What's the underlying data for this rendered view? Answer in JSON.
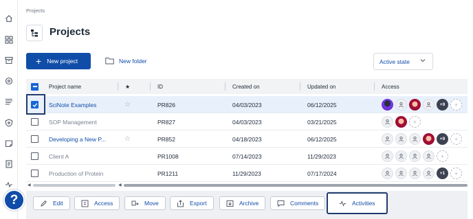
{
  "breadcrumb": "Projects",
  "page_title": "Projects",
  "toolbar": {
    "new_project_label": "New project",
    "new_folder_label": "New folder",
    "state_filter_value": "Active state"
  },
  "table": {
    "columns": [
      "Project name",
      "★",
      "ID",
      "Created on",
      "Updated on",
      "Access"
    ],
    "rows": [
      {
        "name": "SciNote Examples",
        "starred": false,
        "id": "PR826",
        "created": "04/03/2023",
        "updated": "06/12/2025",
        "selected": true,
        "muted": false,
        "extra_count": "+9"
      },
      {
        "name": "SOP Management",
        "starred": false,
        "id": "PR827",
        "created": "04/03/2023",
        "updated": "03/21/2025",
        "selected": false,
        "muted": true,
        "extra_count": ""
      },
      {
        "name": "Developing a New P...",
        "starred": false,
        "id": "PR852",
        "created": "04/18/2023",
        "updated": "06/12/2025",
        "selected": false,
        "muted": false,
        "extra_count": "+9"
      },
      {
        "name": "Client A",
        "starred": false,
        "id": "PR1008",
        "created": "07/14/2023",
        "updated": "11/29/2023",
        "selected": false,
        "muted": true,
        "extra_count": ""
      },
      {
        "name": "Production of Protein",
        "starred": false,
        "id": "PR1211",
        "created": "11/29/2023",
        "updated": "07/17/2024",
        "selected": false,
        "muted": true,
        "extra_count": "+1"
      }
    ]
  },
  "actions": {
    "edit": "Edit",
    "access": "Access",
    "move": "Move",
    "export": "Export",
    "archive": "Archive",
    "comments": "Comments",
    "activities": "Activities"
  },
  "help_label": "?",
  "colors": {
    "primary": "#104da9",
    "checked": "#1766d6",
    "highlight_border": "#1f3a6f"
  }
}
